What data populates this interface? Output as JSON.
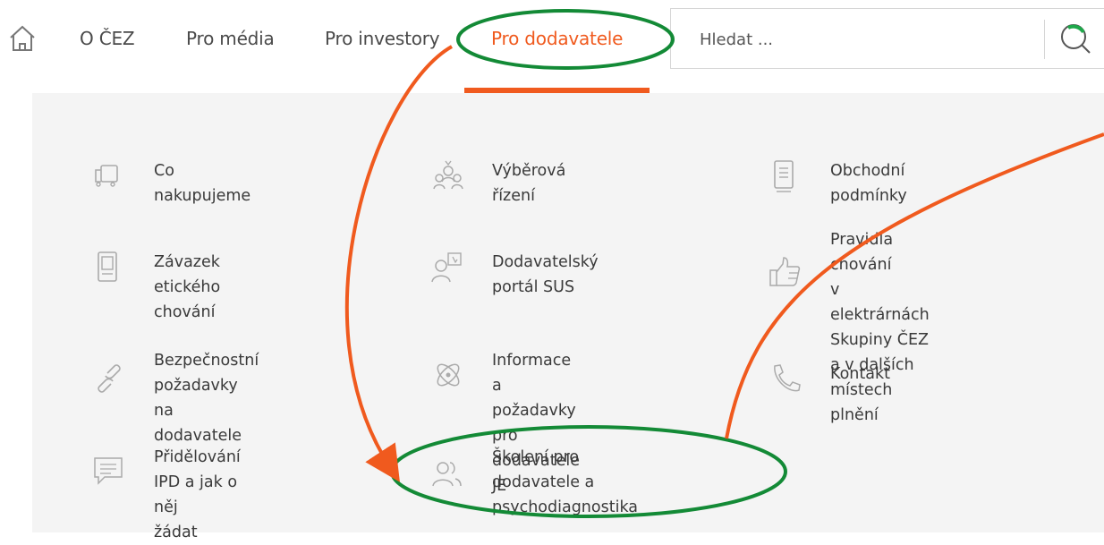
{
  "nav": {
    "home_icon": "home-icon",
    "items": [
      {
        "label": "O ČEZ"
      },
      {
        "label": "Pro média"
      },
      {
        "label": "Pro investory"
      },
      {
        "label": "Pro dodavatele"
      }
    ],
    "active_color": "#f05a1e"
  },
  "search": {
    "placeholder": "Hledat ...",
    "icon": "search-icon"
  },
  "menu": {
    "items": [
      {
        "label": "Co nakupujeme",
        "icon": "truck-icon"
      },
      {
        "label": "Výběrová řízení",
        "icon": "people-group-icon"
      },
      {
        "label": "Obchodní podmínky",
        "icon": "document-icon"
      },
      {
        "label": "Závazek etického chování",
        "icon": "clipboard-icon"
      },
      {
        "label": "Dodavatelský portál SUS",
        "icon": "user-portal-icon"
      },
      {
        "label": "Pravidla chování\nv elektrárnách Skupiny ČEZ\na v dalších místech plnění",
        "icon": "thumbs-up-icon"
      },
      {
        "label": "Bezpečnostní požadavky na\ndodavatele",
        "icon": "link-icon"
      },
      {
        "label": "Informace a požadavky pro\ndodavatele JE",
        "icon": "atom-icon"
      },
      {
        "label": "Kontakt",
        "icon": "phone-icon"
      },
      {
        "label": "Přidělování IPD a jak o něj\nžádat",
        "icon": "chat-icon"
      },
      {
        "label": "Školení pro dodavatele a\npsychodiagnostika",
        "icon": "users-icon"
      }
    ]
  },
  "annotations": {
    "ellipse_color": "#138a36",
    "arrow_color": "#f05a1e"
  }
}
